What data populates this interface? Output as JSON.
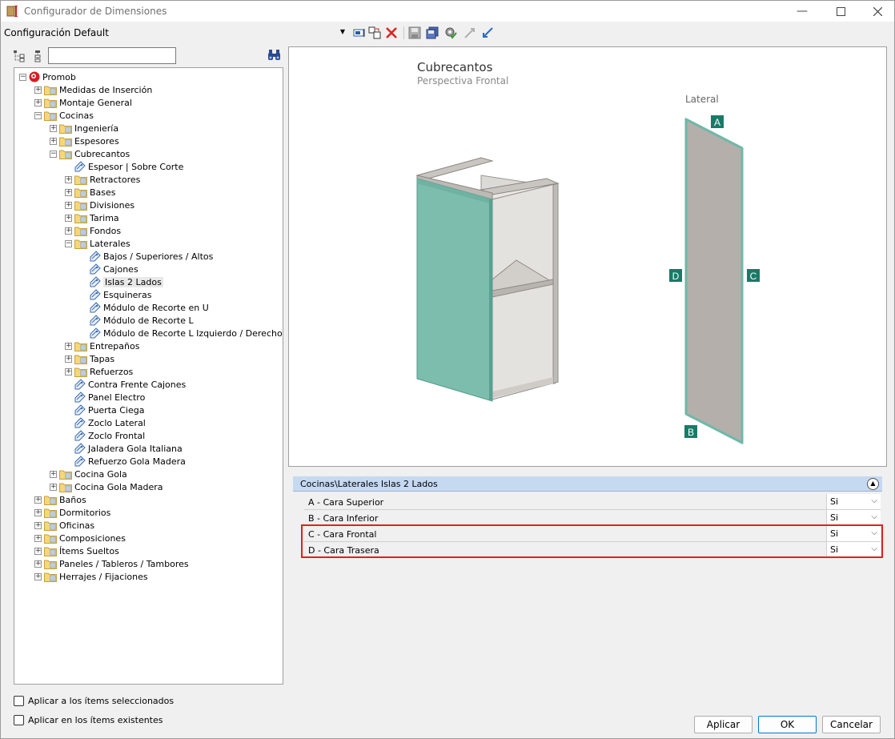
{
  "window": {
    "title": "Configurador de Dimensiones"
  },
  "toolbar": {
    "config_value": "Configuración Default"
  },
  "tree": {
    "items": [
      {
        "label": "Promob",
        "depth": 0,
        "kind": "root",
        "expander": "−"
      },
      {
        "label": "Medidas de Inserción",
        "depth": 1,
        "kind": "folder",
        "expander": "+"
      },
      {
        "label": "Montaje General",
        "depth": 1,
        "kind": "folder",
        "expander": "+"
      },
      {
        "label": "Cocinas",
        "depth": 1,
        "kind": "folder",
        "expander": "−"
      },
      {
        "label": "Ingeniería",
        "depth": 2,
        "kind": "folder",
        "expander": "+"
      },
      {
        "label": "Espesores",
        "depth": 2,
        "kind": "folder",
        "expander": "+"
      },
      {
        "label": "Cubrecantos",
        "depth": 2,
        "kind": "folder",
        "expander": "−"
      },
      {
        "label": "Espesor | Sobre Corte",
        "depth": 3,
        "kind": "leaf",
        "expander": ""
      },
      {
        "label": "Retractores",
        "depth": 3,
        "kind": "folder",
        "expander": "+"
      },
      {
        "label": "Bases",
        "depth": 3,
        "kind": "folder",
        "expander": "+"
      },
      {
        "label": "Divisiones",
        "depth": 3,
        "kind": "folder",
        "expander": "+"
      },
      {
        "label": "Tarima",
        "depth": 3,
        "kind": "folder",
        "expander": "+"
      },
      {
        "label": "Fondos",
        "depth": 3,
        "kind": "folder",
        "expander": "+"
      },
      {
        "label": "Laterales",
        "depth": 3,
        "kind": "folder",
        "expander": "−"
      },
      {
        "label": "Bajos / Superiores / Altos",
        "depth": 4,
        "kind": "leaf",
        "expander": ""
      },
      {
        "label": "Cajones",
        "depth": 4,
        "kind": "leaf",
        "expander": ""
      },
      {
        "label": "Islas 2 Lados",
        "depth": 4,
        "kind": "leaf",
        "expander": "",
        "selected": true
      },
      {
        "label": "Esquineras",
        "depth": 4,
        "kind": "leaf",
        "expander": ""
      },
      {
        "label": "Módulo de Recorte en U",
        "depth": 4,
        "kind": "leaf",
        "expander": ""
      },
      {
        "label": "Módulo de Recorte L",
        "depth": 4,
        "kind": "leaf",
        "expander": ""
      },
      {
        "label": "Módulo de Recorte L Izquierdo / Derecho",
        "depth": 4,
        "kind": "leaf",
        "expander": ""
      },
      {
        "label": "Entrepaños",
        "depth": 3,
        "kind": "folder",
        "expander": "+"
      },
      {
        "label": "Tapas",
        "depth": 3,
        "kind": "folder",
        "expander": "+"
      },
      {
        "label": "Refuerzos",
        "depth": 3,
        "kind": "folder",
        "expander": "+"
      },
      {
        "label": "Contra Frente Cajones",
        "depth": 3,
        "kind": "leaf",
        "expander": ""
      },
      {
        "label": "Panel Electro",
        "depth": 3,
        "kind": "leaf",
        "expander": ""
      },
      {
        "label": "Puerta Ciega",
        "depth": 3,
        "kind": "leaf",
        "expander": ""
      },
      {
        "label": "Zoclo Lateral",
        "depth": 3,
        "kind": "leaf",
        "expander": ""
      },
      {
        "label": "Zoclo Frontal",
        "depth": 3,
        "kind": "leaf",
        "expander": ""
      },
      {
        "label": "Jaladera Gola Italiana",
        "depth": 3,
        "kind": "leaf",
        "expander": ""
      },
      {
        "label": "Refuerzo Gola Madera",
        "depth": 3,
        "kind": "leaf",
        "expander": ""
      },
      {
        "label": "Cocina Gola",
        "depth": 2,
        "kind": "folder",
        "expander": "+"
      },
      {
        "label": "Cocina Gola Madera",
        "depth": 2,
        "kind": "folder",
        "expander": "+"
      },
      {
        "label": "Baños",
        "depth": 1,
        "kind": "folder",
        "expander": "+"
      },
      {
        "label": "Dormitorios",
        "depth": 1,
        "kind": "folder",
        "expander": "+"
      },
      {
        "label": "Oficinas",
        "depth": 1,
        "kind": "folder",
        "expander": "+"
      },
      {
        "label": "Composiciones",
        "depth": 1,
        "kind": "folder",
        "expander": "+"
      },
      {
        "label": "Ítems Sueltos",
        "depth": 1,
        "kind": "folder",
        "expander": "+"
      },
      {
        "label": "Paneles / Tableros / Tambores",
        "depth": 1,
        "kind": "folder",
        "expander": "+"
      },
      {
        "label": "Herrajes / Fijaciones",
        "depth": 1,
        "kind": "folder",
        "expander": "+"
      }
    ]
  },
  "options": {
    "apply_selected": "Aplicar a los ítems seleccionados",
    "apply_existing": "Aplicar en los ítems existentes"
  },
  "preview": {
    "title": "Cubrecantos",
    "subtitle": "Perspectiva Frontal",
    "lateral_label": "Lateral",
    "markers": {
      "a": "A",
      "b": "B",
      "c": "C",
      "d": "D"
    },
    "colors": {
      "edge": "#6fb8a8",
      "panel": "#b4afab",
      "marker": "#1a7a68"
    }
  },
  "grid": {
    "header": "Cocinas\\Laterales Islas 2 Lados",
    "rows": [
      {
        "name": "A - Cara Superior",
        "value": "Si"
      },
      {
        "name": "B - Cara Inferior",
        "value": "Si"
      },
      {
        "name": "C - Cara Frontal",
        "value": "Si"
      },
      {
        "name": "D - Cara Trasera",
        "value": "Si"
      }
    ]
  },
  "buttons": {
    "apply": "Aplicar",
    "ok": "OK",
    "cancel": "Cancelar"
  }
}
